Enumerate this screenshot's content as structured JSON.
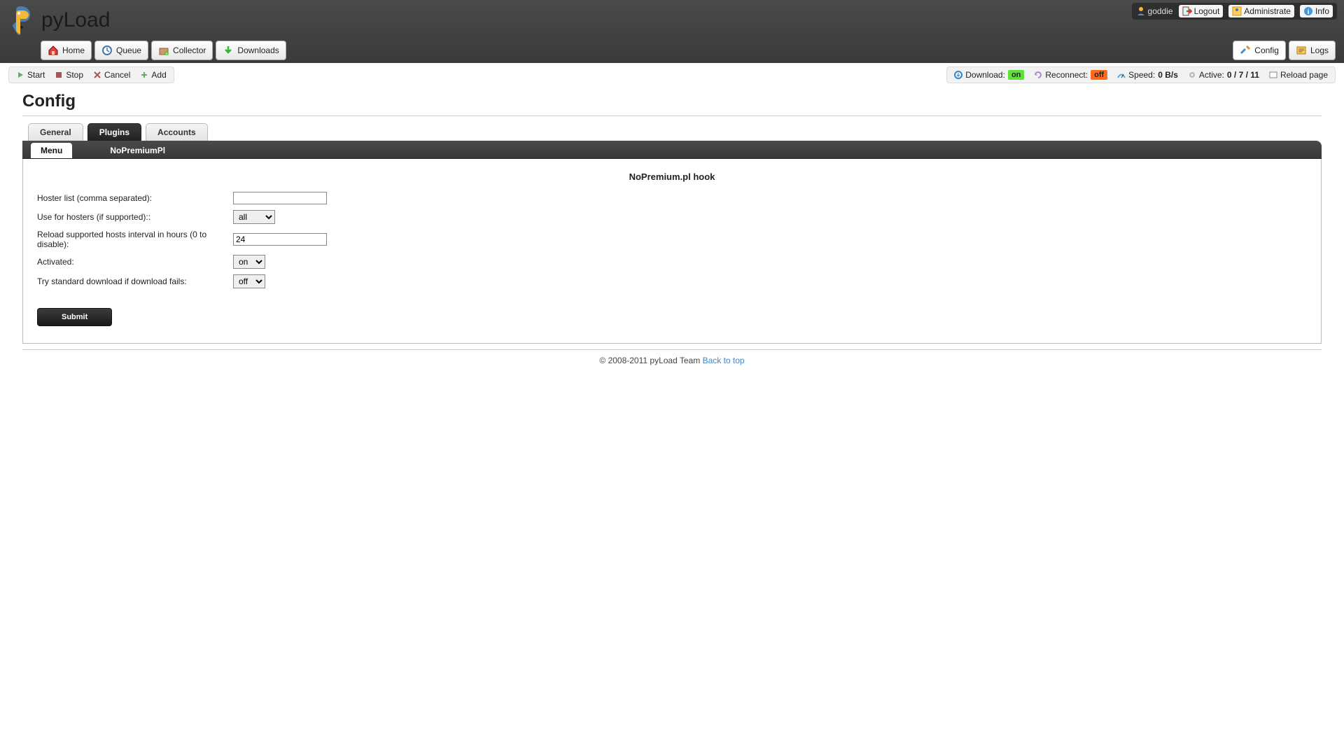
{
  "brand": "pyLoad",
  "user": {
    "name": "goddie"
  },
  "userbar": {
    "logout": "Logout",
    "admin": "Administrate",
    "info": "Info"
  },
  "nav": {
    "home": "Home",
    "queue": "Queue",
    "collector": "Collector",
    "downloads": "Downloads",
    "config": "Config",
    "logs": "Logs"
  },
  "toolbar": {
    "start": "Start",
    "stop": "Stop",
    "cancel": "Cancel",
    "add": "Add"
  },
  "status": {
    "download_label": "Download:",
    "download_state": "on",
    "reconnect_label": "Reconnect:",
    "reconnect_state": "off",
    "speed_label": "Speed:",
    "speed_value": "0 B/s",
    "active_label": "Active:",
    "active_value": "0 / 7 / 11",
    "reload": "Reload page"
  },
  "page": {
    "title": "Config"
  },
  "tabs": {
    "general": "General",
    "plugins": "Plugins",
    "accounts": "Accounts"
  },
  "subtabs": {
    "menu": "Menu",
    "plugin": "NoPremiumPl"
  },
  "form": {
    "title": "NoPremium.pl hook",
    "hoster_list_label": "Hoster list (comma separated):",
    "hoster_list_value": "",
    "use_for_hosters_label": "Use for hosters (if supported)::",
    "use_for_hosters_value": "all",
    "reload_interval_label": "Reload supported hosts interval in hours (0 to disable):",
    "reload_interval_value": "24",
    "activated_label": "Activated:",
    "activated_value": "on",
    "try_standard_label": "Try standard download if download fails:",
    "try_standard_value": "off",
    "submit": "Submit"
  },
  "footer": {
    "copyright": "© 2008-2011 pyLoad Team ",
    "backtotop": "Back to top"
  }
}
